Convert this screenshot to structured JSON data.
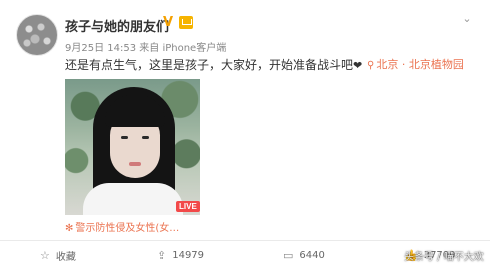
{
  "post": {
    "username": "孩子与她的朋友们",
    "timestamp": "9月25日 14:53",
    "source": "来自 iPhone客户端",
    "text": "还是有点生气，这里是孩子，大家好，开始准备战斗吧",
    "heart": "❤",
    "location": "北京 · 北京植物园",
    "caption": "警示防性侵及女性(女…",
    "live_badge": "LIVE"
  },
  "actions": {
    "favorite": "收藏",
    "share_count": "14979",
    "comment_count": "6440",
    "like_count": "37709"
  },
  "watermark": "头条号 / 喵不大欢",
  "icons": {
    "more": "chevron-down-icon",
    "location": "location-pin-icon",
    "favorite": "star-icon",
    "share": "share-icon",
    "comment": "comment-icon",
    "like": "thumbs-up-icon"
  },
  "colors": {
    "accent": "#eb7350",
    "verified": "#f4a000",
    "live": "#f24949"
  }
}
